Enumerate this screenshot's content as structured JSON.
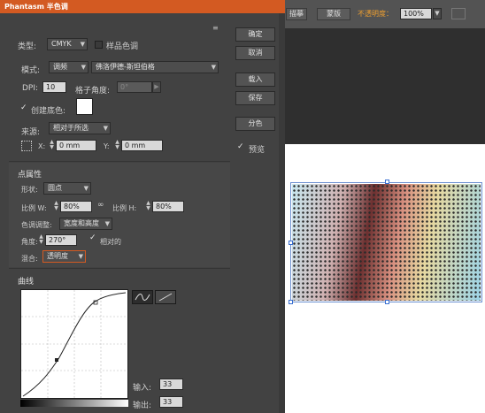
{
  "title": "Phantasm 半色调",
  "host_toolbar": {
    "btn_1": "描摹",
    "btn_2": "蒙版",
    "opacity_label": "不透明度：",
    "opacity_value": "100%"
  },
  "buttons": {
    "ok": "确定",
    "cancel": "取消",
    "load": "载入",
    "save": "保存",
    "separate": "分色",
    "preview": "预览"
  },
  "top": {
    "type_label": "类型:",
    "type_value": "CMYK",
    "sample_color": "样品色调",
    "mode_label": "模式:",
    "mode_value": "调频",
    "mode_algo": "佛洛伊德-斯坦伯格",
    "dpi_label": "DPI:",
    "dpi_value": "10",
    "grid_angle_label": "格子角度:",
    "grid_angle_value": "0°",
    "create_bg": "创建底色:",
    "source_label": "来源:",
    "source_value": "相对于所选",
    "x_label": "X:",
    "x_value": "0 mm",
    "y_label": "Y:",
    "y_value": "0 mm"
  },
  "dot": {
    "title": "点属性",
    "shape_label": "形状:",
    "shape_value": "圆点",
    "scale_w_label": "比例 W:",
    "scale_w_value": "80%",
    "scale_h_label": "比例 H:",
    "scale_h_value": "80%",
    "adjust_label": "色调调整:",
    "adjust_value": "宽度和高度",
    "angle_label": "角度:",
    "angle_value": "270°",
    "relative": "相对的",
    "blend_label": "混合:",
    "blend_value": "透明度"
  },
  "curve": {
    "title": "曲线",
    "input_label": "输入:",
    "input_value": "33",
    "output_label": "输出:",
    "output_value": "33"
  }
}
